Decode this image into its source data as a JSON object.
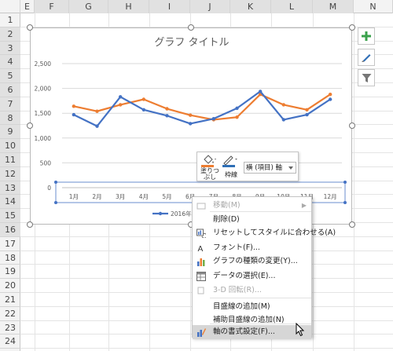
{
  "columns": [
    "E",
    "F",
    "G",
    "H",
    "I",
    "J",
    "K",
    "L",
    "M",
    "N"
  ],
  "rows": [
    "1",
    "2",
    "3",
    "4",
    "5",
    "6",
    "7",
    "8",
    "9",
    "10",
    "11",
    "12",
    "13",
    "14",
    "15",
    "16",
    "17",
    "18",
    "19",
    "20",
    "21",
    "22",
    "23",
    "24"
  ],
  "chart_data": {
    "type": "line",
    "title": "グラフ タイトル",
    "categories": [
      "1月",
      "2月",
      "3月",
      "4月",
      "5月",
      "6月",
      "7月",
      "8月",
      "9月",
      "10月",
      "11月",
      "12月"
    ],
    "series": [
      {
        "name": "2016年",
        "color": "#4472c4",
        "values": [
          1470,
          1240,
          1830,
          1570,
          1450,
          1290,
          1390,
          1600,
          1940,
          1370,
          1470,
          1780
        ]
      },
      {
        "name": "",
        "color": "#ed7d31",
        "values": [
          1640,
          1540,
          1670,
          1780,
          1590,
          1460,
          1370,
          1420,
          1880,
          1670,
          1570,
          1880
        ]
      }
    ],
    "yticks": [
      "0",
      "500",
      "1,000",
      "1,500",
      "2,000",
      "2,500"
    ],
    "ylim": [
      0,
      2500
    ],
    "grid": true,
    "legend_position": "bottom"
  },
  "side_buttons": [
    {
      "icon": "chart-elements-plus-icon",
      "color": "#3aa14b"
    },
    {
      "icon": "chart-styles-brush-icon",
      "color": "#2f6fb6"
    },
    {
      "icon": "chart-filter-icon",
      "color": "#777777"
    }
  ],
  "minitoolbar": {
    "fill_label": "塗りつぶし",
    "outline_label": "枠線",
    "selector_value": "横 (項目) 軸",
    "fill_color": "#ed7d31",
    "outline_color": "#2f6fb6"
  },
  "context_menu": [
    {
      "label": "移動(M)",
      "icon": "move-icon",
      "disabled": true,
      "submenu": true
    },
    {
      "label": "削除(D)",
      "icon": "",
      "disabled": false
    },
    {
      "label": "リセットしてスタイルに合わせる(A)",
      "icon": "reset-style-icon",
      "disabled": false
    },
    {
      "label": "フォント(F)...",
      "icon": "font-icon",
      "disabled": false
    },
    {
      "label": "グラフの種類の変更(Y)...",
      "icon": "chart-type-icon",
      "disabled": false
    },
    {
      "label": "データの選択(E)...",
      "icon": "select-data-icon",
      "disabled": false
    },
    {
      "label": "3-D 回転(R)...",
      "icon": "3d-rotate-icon",
      "disabled": true
    },
    {
      "label": "目盛線の追加(M)",
      "icon": "",
      "disabled": false
    },
    {
      "label": "補助目盛線の追加(N)",
      "icon": "",
      "disabled": false
    },
    {
      "label": "軸の書式設定(F)...",
      "icon": "format-axis-icon",
      "disabled": false,
      "highlighted": true
    }
  ]
}
